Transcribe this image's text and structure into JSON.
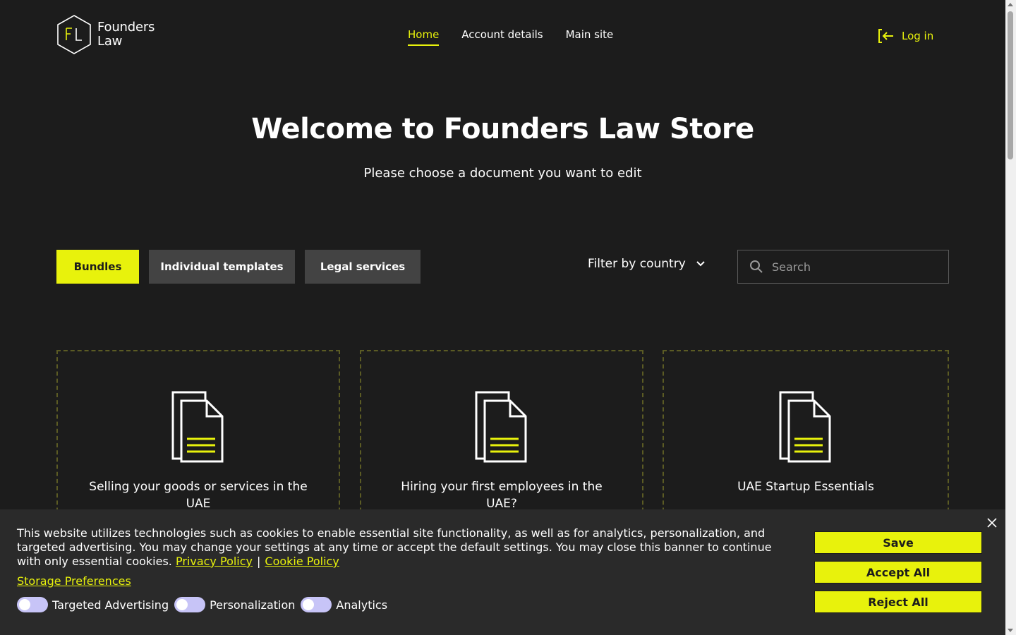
{
  "header": {
    "logo": {
      "line1": "Founders",
      "line2": "Law",
      "mark": "FL"
    },
    "nav": [
      {
        "label": "Home",
        "active": true
      },
      {
        "label": "Account details",
        "active": false
      },
      {
        "label": "Main site",
        "active": false
      }
    ],
    "login_label": "Log in"
  },
  "hero": {
    "title": "Welcome to Founders Law Store",
    "subtitle": "Please choose a document you want to edit"
  },
  "filters": {
    "tabs": [
      {
        "label": "Bundles",
        "active": true
      },
      {
        "label": "Individual templates",
        "active": false
      },
      {
        "label": "Legal services",
        "active": false
      }
    ],
    "country_filter_label": "Filter by country",
    "search_placeholder": "Search"
  },
  "cards": [
    {
      "title": "Selling your goods or services in the UAE",
      "icon": "document-icon"
    },
    {
      "title": "Hiring your first employees in the UAE?",
      "icon": "document-icon"
    },
    {
      "title": "UAE Startup Essentials",
      "icon": "document-icon"
    }
  ],
  "cookie_banner": {
    "text": "This website utilizes technologies such as cookies to enable essential site functionality, as well as for analytics, personalization, and targeted advertising. You may change your settings at any time or accept the default settings. You may close this banner to continue with only essential cookies.",
    "privacy_link": "Privacy Policy",
    "separator": "|",
    "cookie_link": "Cookie Policy",
    "storage_prefs_link": "Storage Preferences",
    "toggles": [
      {
        "label": "Targeted Advertising",
        "on": false
      },
      {
        "label": "Personalization",
        "on": false
      },
      {
        "label": "Analytics",
        "on": false
      }
    ],
    "buttons": {
      "save": "Save",
      "accept_all": "Accept All",
      "reject_all": "Reject All"
    }
  },
  "colors": {
    "accent": "#e8f20c",
    "background": "#1c1c1c",
    "banner": "#2a2a2a",
    "tab_inactive": "#434343",
    "toggle_off": "#c7c4f7"
  }
}
